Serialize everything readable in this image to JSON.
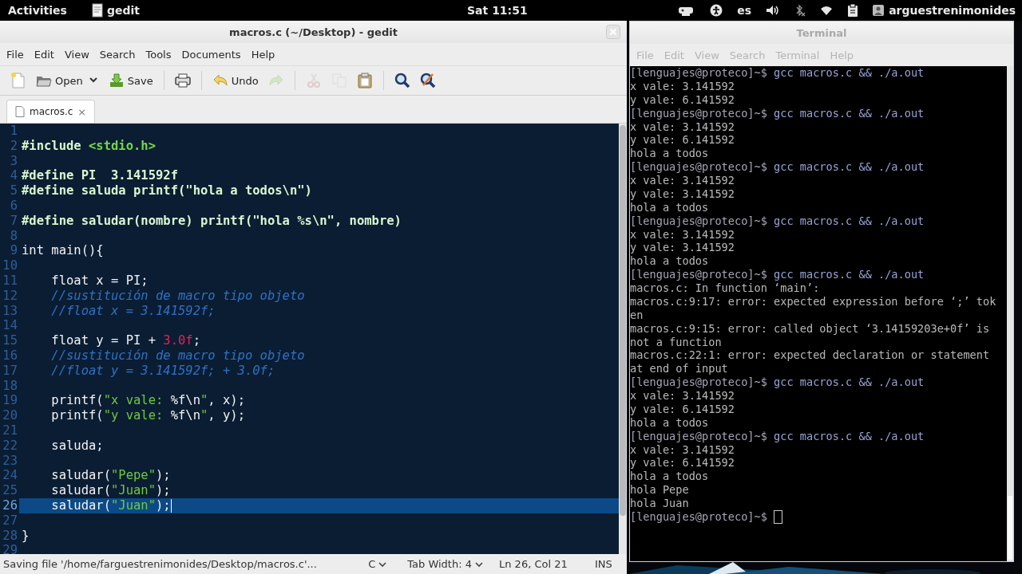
{
  "top_bar": {
    "activities": "Activities",
    "app": "gedit",
    "clock": "Sat 11:51",
    "language": "es",
    "user": "arguestrenimonides"
  },
  "gedit": {
    "focused": true,
    "title": "macros.c (~/Desktop) - gedit",
    "menu": [
      "File",
      "Edit",
      "View",
      "Search",
      "Tools",
      "Documents",
      "Help"
    ],
    "toolbar": [
      [
        {
          "kind": "new",
          "disabled": false
        },
        {
          "kind": "open",
          "label": "Open",
          "disabled": false
        },
        {
          "kind": "save",
          "label": "Save",
          "disabled": false
        }
      ],
      [
        {
          "kind": "print",
          "disabled": false
        }
      ],
      [
        {
          "kind": "undo",
          "label": "Undo",
          "disabled": false
        },
        {
          "kind": "redo",
          "disabled": true
        }
      ],
      [
        {
          "kind": "cut",
          "disabled": true
        },
        {
          "kind": "copy",
          "disabled": true
        },
        {
          "kind": "paste",
          "disabled": false
        }
      ],
      [
        {
          "kind": "search",
          "disabled": false
        },
        {
          "kind": "replace",
          "disabled": false
        }
      ]
    ],
    "tabs": [
      {
        "label": "macros.c",
        "close": "×",
        "selected": true
      }
    ],
    "lines": [
      {
        "number": "1",
        "current": false
      },
      {
        "number": "2",
        "current": false,
        "tokens": [
          {
            "kind": "preproc",
            "text": "#include "
          },
          {
            "kind": "include",
            "text": "<stdio.h>"
          }
        ]
      },
      {
        "number": "3",
        "current": false
      },
      {
        "number": "4",
        "current": false,
        "tokens": [
          {
            "kind": "preproc",
            "text": "#define PI  3.141592f"
          }
        ]
      },
      {
        "number": "5",
        "current": false,
        "tokens": [
          {
            "kind": "preproc",
            "text": "#define saluda printf(\"hola a todos\\n\")"
          }
        ]
      },
      {
        "number": "6",
        "current": false
      },
      {
        "number": "7",
        "current": false,
        "tokens": [
          {
            "kind": "preproc",
            "text": "#define saludar(nombre) printf(\"hola %s\\n\", nombre)"
          }
        ]
      },
      {
        "number": "8",
        "current": false
      },
      {
        "number": "9",
        "current": false,
        "tokens": [
          {
            "kind": "plain",
            "text": "int main(){"
          }
        ]
      },
      {
        "number": "10",
        "current": false
      },
      {
        "number": "11",
        "current": false,
        "tokens": [
          {
            "kind": "plain",
            "text": "    float x = PI;"
          }
        ]
      },
      {
        "number": "12",
        "current": false,
        "tokens": [
          {
            "kind": "comment",
            "text": "    //sustitución de macro tipo objeto"
          }
        ]
      },
      {
        "number": "13",
        "current": false,
        "tokens": [
          {
            "kind": "comment",
            "text": "    //float x = 3.141592f;"
          }
        ]
      },
      {
        "number": "14",
        "current": false
      },
      {
        "number": "15",
        "current": false,
        "tokens": [
          {
            "kind": "plain",
            "text": "    float y = PI + "
          },
          {
            "kind": "number",
            "text": "3.0f"
          },
          {
            "kind": "plain",
            "text": ";"
          }
        ]
      },
      {
        "number": "16",
        "current": false,
        "tokens": [
          {
            "kind": "comment",
            "text": "    //sustitución de macro tipo objeto"
          }
        ]
      },
      {
        "number": "17",
        "current": false,
        "tokens": [
          {
            "kind": "comment",
            "text": "    //float y = 3.141592f; + 3.0f;"
          }
        ]
      },
      {
        "number": "18",
        "current": false
      },
      {
        "number": "19",
        "current": false,
        "tokens": [
          {
            "kind": "plain",
            "text": "    printf("
          },
          {
            "kind": "string",
            "text": "\"x vale: "
          },
          {
            "kind": "plain",
            "text": "%f\\n"
          },
          {
            "kind": "string",
            "text": "\""
          },
          {
            "kind": "plain",
            "text": ", x);"
          }
        ]
      },
      {
        "number": "20",
        "current": false,
        "tokens": [
          {
            "kind": "plain",
            "text": "    printf("
          },
          {
            "kind": "string",
            "text": "\"y vale: "
          },
          {
            "kind": "plain",
            "text": "%f\\n"
          },
          {
            "kind": "string",
            "text": "\""
          },
          {
            "kind": "plain",
            "text": ", y);"
          }
        ]
      },
      {
        "number": "21",
        "current": false
      },
      {
        "number": "22",
        "current": false,
        "tokens": [
          {
            "kind": "plain",
            "text": "    saluda;"
          }
        ]
      },
      {
        "number": "23",
        "current": false
      },
      {
        "number": "24",
        "current": false,
        "tokens": [
          {
            "kind": "plain",
            "text": "    saludar("
          },
          {
            "kind": "string",
            "text": "\"Pepe\""
          },
          {
            "kind": "plain",
            "text": ");"
          }
        ]
      },
      {
        "number": "25",
        "current": false,
        "tokens": [
          {
            "kind": "plain",
            "text": "    saludar("
          },
          {
            "kind": "string",
            "text": "\"Juan\""
          },
          {
            "kind": "plain",
            "text": ");"
          }
        ]
      },
      {
        "number": "26",
        "current": true,
        "tokens": [
          {
            "kind": "plain",
            "text": "    saludar("
          },
          {
            "kind": "string",
            "text": "\"Juan\""
          },
          {
            "kind": "plain",
            "text": ");"
          }
        ]
      },
      {
        "number": "27",
        "current": false
      },
      {
        "number": "28",
        "current": false,
        "tokens": [
          {
            "kind": "plain",
            "text": "}"
          }
        ]
      },
      {
        "number": "29",
        "current": false
      }
    ],
    "status": {
      "message": "Saving file '/home/farguestrenimonides/Desktop/macros.c'...",
      "language": "C",
      "tab_width": "Tab Width: 4",
      "position": "Ln 26, Col 21",
      "mode": "INS"
    }
  },
  "terminal": {
    "focused": false,
    "title": "Terminal",
    "menu": [
      "File",
      "Edit",
      "View",
      "Search",
      "Terminal",
      "Help"
    ],
    "lines": [
      {
        "kind": "prompt",
        "prompt": "[lenguajes@proteco]~$",
        "command": "gcc macros.c && ./a.out",
        "cursor": false
      },
      {
        "kind": "output",
        "text": "x vale: 3.141592"
      },
      {
        "kind": "output",
        "text": "y vale: 6.141592"
      },
      {
        "kind": "prompt",
        "prompt": "[lenguajes@proteco]~$",
        "command": "gcc macros.c && ./a.out",
        "cursor": false
      },
      {
        "kind": "output",
        "text": "x vale: 3.141592"
      },
      {
        "kind": "output",
        "text": "y vale: 6.141592"
      },
      {
        "kind": "output",
        "text": "hola a todos"
      },
      {
        "kind": "prompt",
        "prompt": "[lenguajes@proteco]~$",
        "command": "gcc macros.c && ./a.out",
        "cursor": false
      },
      {
        "kind": "output",
        "text": "x vale: 3.141592"
      },
      {
        "kind": "output",
        "text": "y vale: 3.141592"
      },
      {
        "kind": "output",
        "text": "hola a todos"
      },
      {
        "kind": "prompt",
        "prompt": "[lenguajes@proteco]~$",
        "command": "gcc macros.c && ./a.out",
        "cursor": false
      },
      {
        "kind": "output",
        "text": "x vale: 3.141592"
      },
      {
        "kind": "output",
        "text": "y vale: 3.141592"
      },
      {
        "kind": "output",
        "text": "hola a todos"
      },
      {
        "kind": "prompt",
        "prompt": "[lenguajes@proteco]~$",
        "command": "gcc macros.c && ./a.out",
        "cursor": false
      },
      {
        "kind": "output",
        "text": "macros.c: In function ‘main’:"
      },
      {
        "kind": "output",
        "text": "macros.c:9:17: error: expected expression before ‘;’ tok"
      },
      {
        "kind": "output",
        "text": "en"
      },
      {
        "kind": "output",
        "text": "macros.c:9:15: error: called object ‘3.14159203e+0f’ is"
      },
      {
        "kind": "output",
        "text": "not a function"
      },
      {
        "kind": "output",
        "text": "macros.c:22:1: error: expected declaration or statement"
      },
      {
        "kind": "output",
        "text": "at end of input"
      },
      {
        "kind": "prompt",
        "prompt": "[lenguajes@proteco]~$",
        "command": "gcc macros.c && ./a.out",
        "cursor": false
      },
      {
        "kind": "output",
        "text": "x vale: 3.141592"
      },
      {
        "kind": "output",
        "text": "y vale: 6.141592"
      },
      {
        "kind": "output",
        "text": "hola a todos"
      },
      {
        "kind": "prompt",
        "prompt": "[lenguajes@proteco]~$",
        "command": "gcc macros.c && ./a.out",
        "cursor": false
      },
      {
        "kind": "output",
        "text": "x vale: 3.141592"
      },
      {
        "kind": "output",
        "text": "y vale: 6.141592"
      },
      {
        "kind": "output",
        "text": "hola a todos"
      },
      {
        "kind": "output",
        "text": "hola Pepe"
      },
      {
        "kind": "output",
        "text": "hola Juan"
      },
      {
        "kind": "prompt",
        "prompt": "[lenguajes@proteco]~$",
        "cursor": true
      }
    ]
  }
}
